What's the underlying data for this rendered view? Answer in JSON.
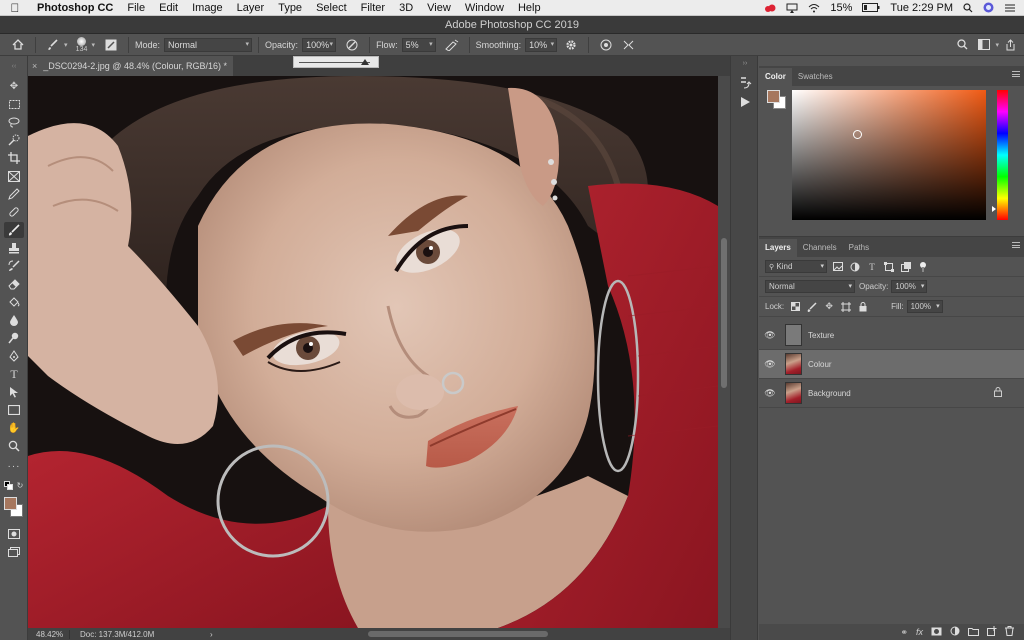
{
  "menubar": {
    "app_name": "Photoshop CC",
    "menus": [
      "File",
      "Edit",
      "Image",
      "Layer",
      "Type",
      "Select",
      "Filter",
      "3D",
      "View",
      "Window",
      "Help"
    ],
    "battery": "15%",
    "clock": "Tue 2:29 PM"
  },
  "window": {
    "title": "Adobe Photoshop CC 2019"
  },
  "options": {
    "brush_size": "134",
    "mode_label": "Mode:",
    "mode_value": "Normal",
    "opacity_label": "Opacity:",
    "opacity_value": "100%",
    "flow_label": "Flow:",
    "flow_value": "5%",
    "smoothing_label": "Smoothing:",
    "smoothing_value": "10%",
    "flow_slider_fraction": 0.05
  },
  "document": {
    "tab_label": "_DSC0294-2.jpg @ 48.4% (Colour, RGB/16) *"
  },
  "status": {
    "zoom": "48.42%",
    "doc_info": "Doc: 137.3M/412.0M"
  },
  "color_panel": {
    "tabs": [
      "Color",
      "Swatches"
    ],
    "foreground": "#a6775e",
    "background": "#ffffff",
    "picker_hue": "#f05a14"
  },
  "layers_panel": {
    "tabs": [
      "Layers",
      "Channels",
      "Paths"
    ],
    "filter_kind": "Kind",
    "blend_mode": "Normal",
    "opacity_label": "Opacity:",
    "opacity_value": "100%",
    "lock_label": "Lock:",
    "fill_label": "Fill:",
    "fill_value": "100%",
    "layers": [
      {
        "name": "Texture",
        "visible": true,
        "selected": false,
        "locked": false
      },
      {
        "name": "Colour",
        "visible": true,
        "selected": true,
        "locked": false
      },
      {
        "name": "Background",
        "visible": true,
        "selected": false,
        "locked": true
      }
    ]
  },
  "colors": {
    "ui_dark": "#535353",
    "sweater": "#a3202a",
    "skin": "#d2ad98"
  }
}
